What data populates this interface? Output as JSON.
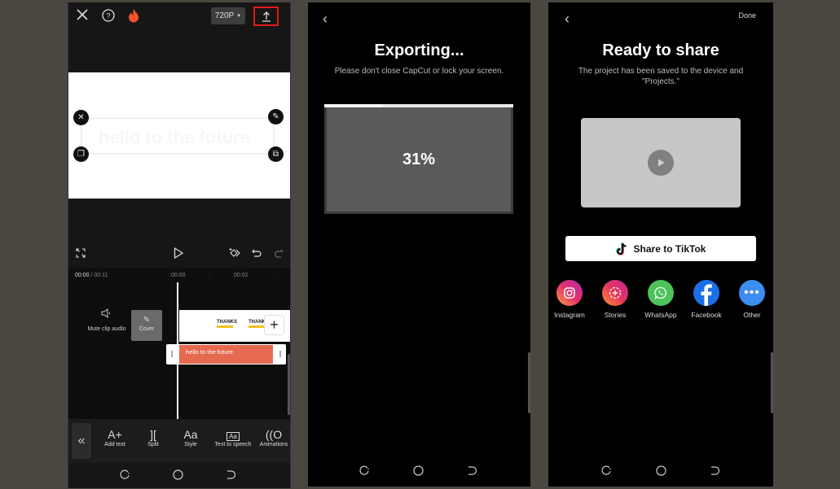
{
  "editor": {
    "resolution": "720P",
    "time_current": "00:00",
    "time_total": "/ 00:11",
    "ruler_marks": [
      "00:00",
      "00:02"
    ],
    "mute_label": "Mute clip audio",
    "cover_label": "Cover",
    "text_clip": "hello to the future",
    "thumb_text": "THANKS",
    "tools": [
      {
        "label": "Add text",
        "glyph": "A+"
      },
      {
        "label": "Split",
        "glyph": "]["
      },
      {
        "label": "Style",
        "glyph": "Aa"
      },
      {
        "label": "Text to speech",
        "glyph": "Aa"
      },
      {
        "label": "Animations",
        "glyph": "((O"
      }
    ],
    "highlight_color": "#e21b1b"
  },
  "exporting": {
    "title": "Exporting...",
    "subtitle": "Please don't close CapCut or lock your screen.",
    "progress_label": "31%",
    "progress": 0.31
  },
  "share": {
    "done_label": "Done",
    "title": "Ready to share",
    "subtitle": "The project has been saved to the device and \"Projects.\"",
    "tiktok_label": "Share to TikTok",
    "targets": [
      {
        "label": "Instagram",
        "color": "#d6287a"
      },
      {
        "label": "Stories",
        "color": "#e8345e"
      },
      {
        "label": "WhatsApp",
        "color": "#4fc35a"
      },
      {
        "label": "Facebook",
        "color": "#1a6fe8"
      },
      {
        "label": "Other",
        "color": "#3d8cf0"
      }
    ]
  }
}
